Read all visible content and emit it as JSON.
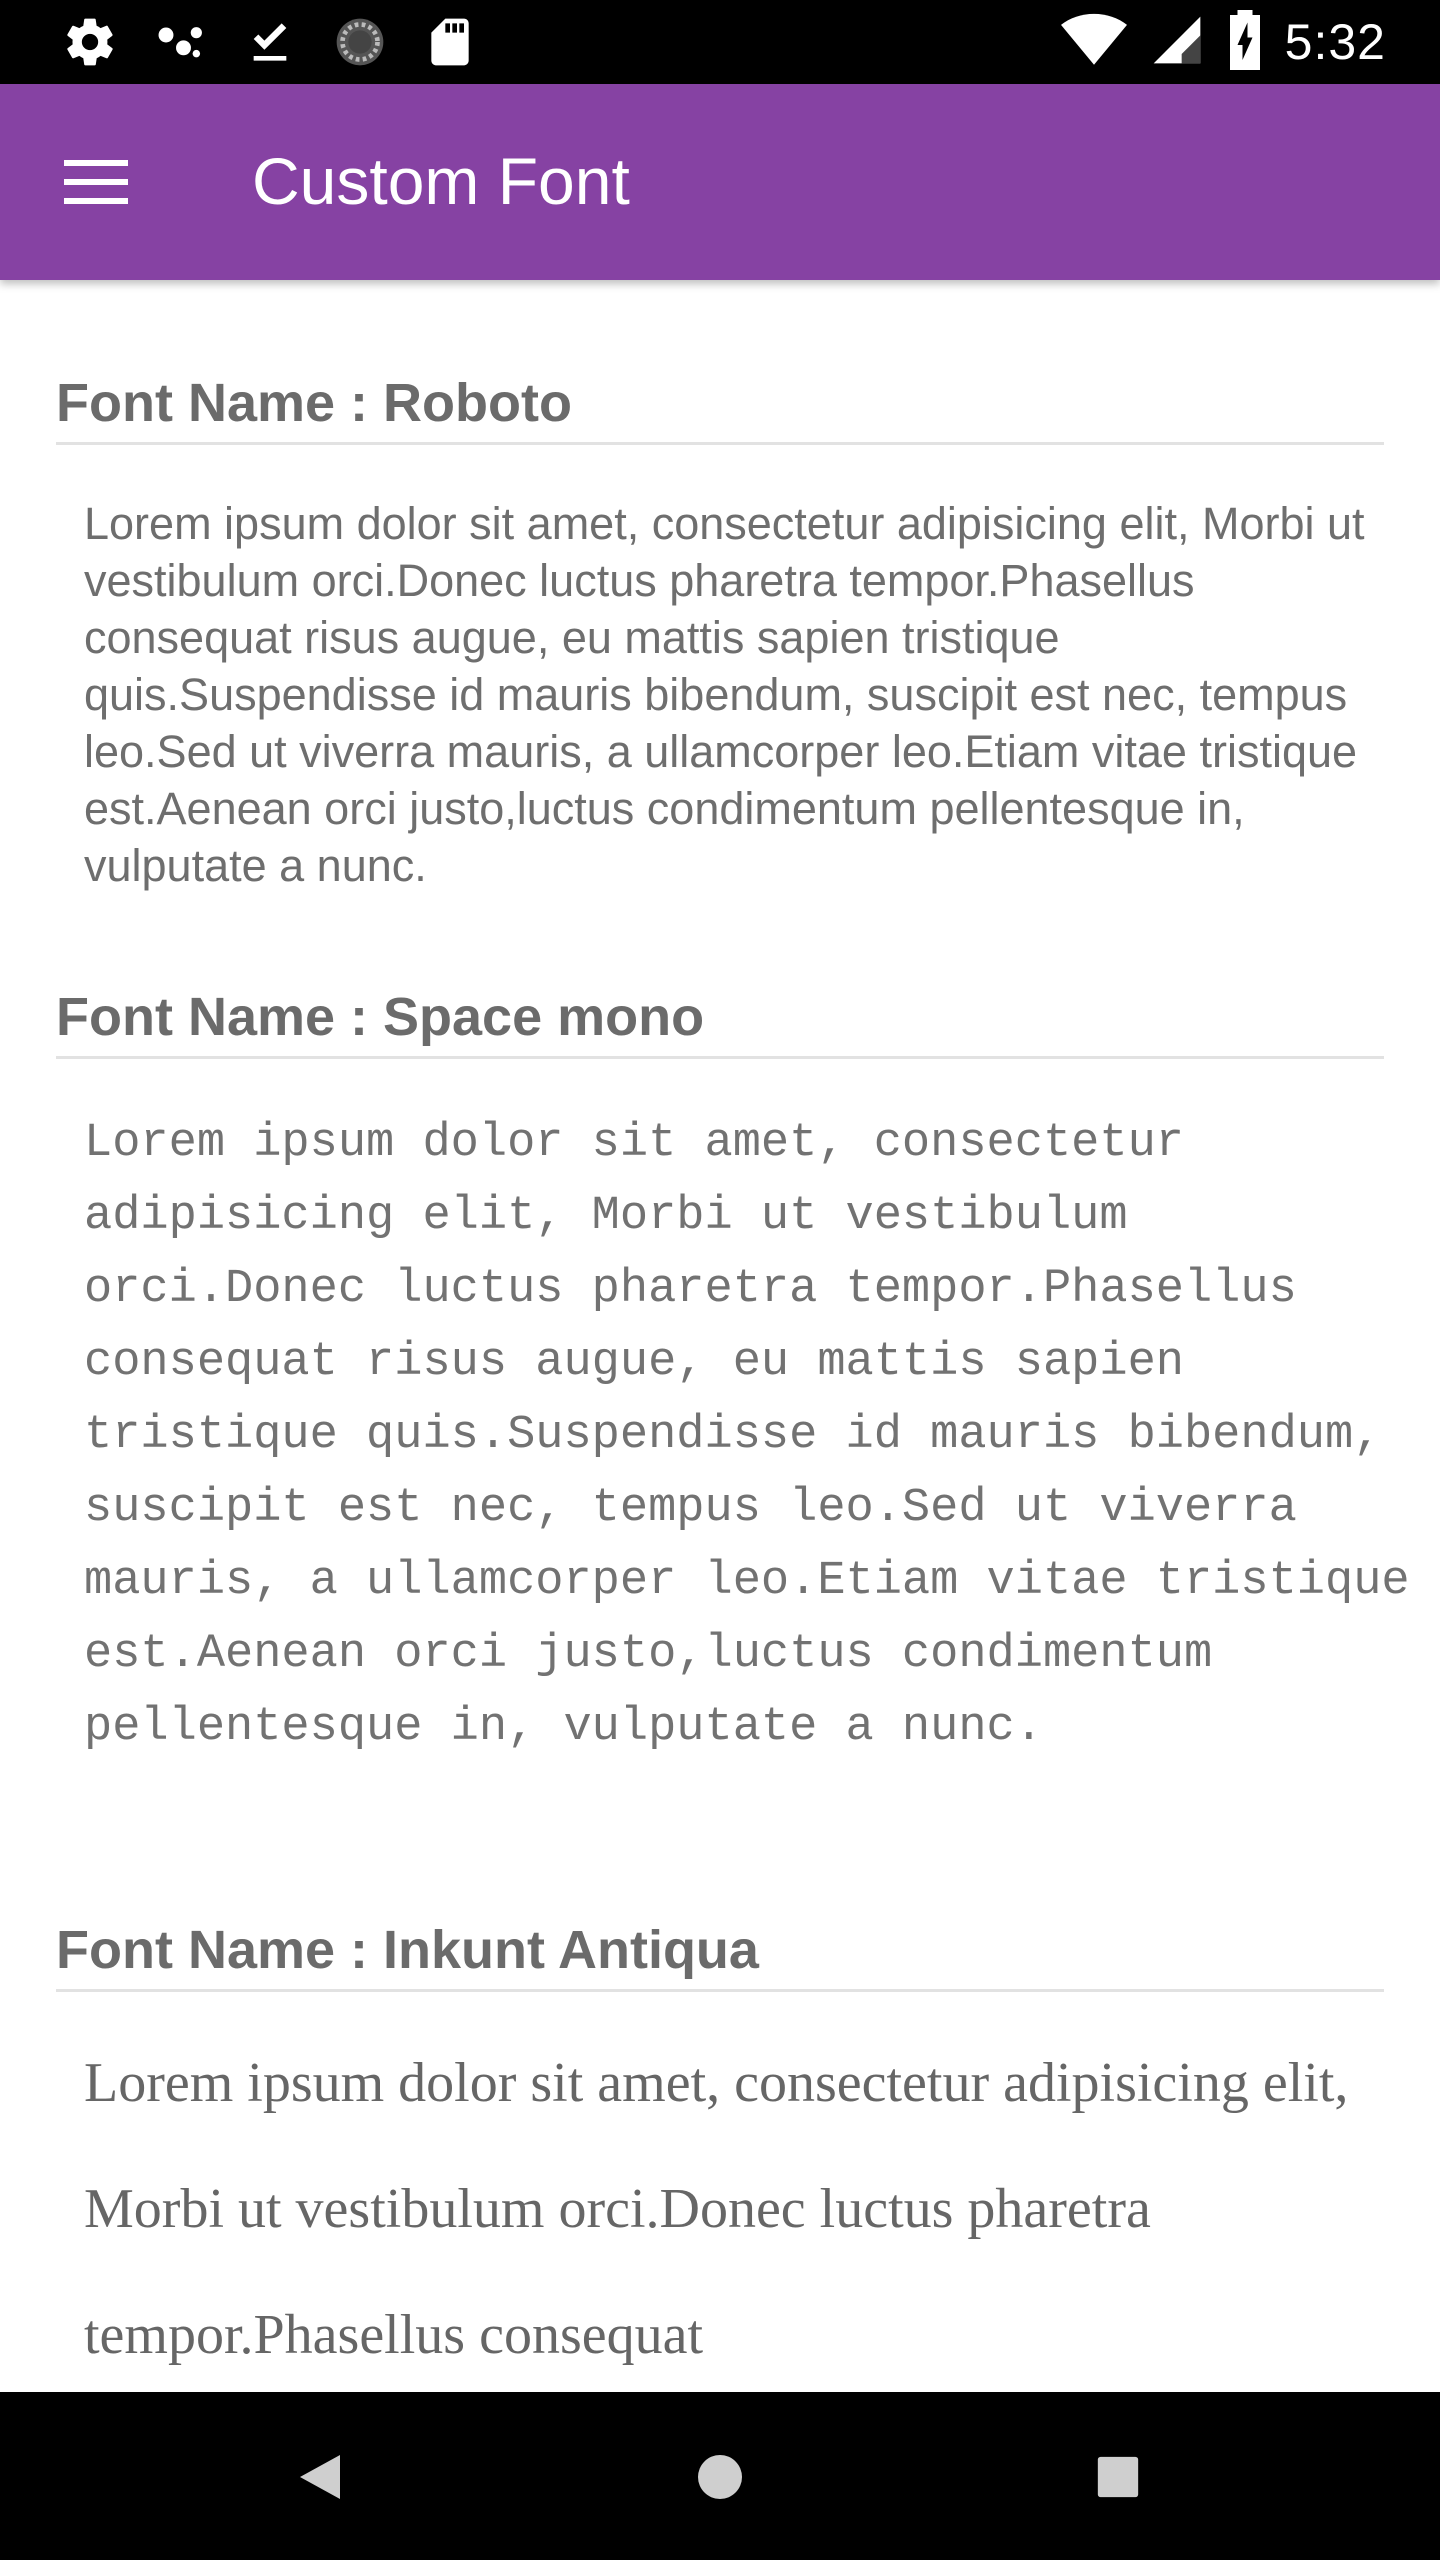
{
  "status_bar": {
    "left_icons": [
      "settings-icon",
      "network-dots-icon",
      "download-done-icon",
      "sync-circle-icon",
      "sd-card-icon"
    ],
    "right_icons": [
      "wifi-icon",
      "signal-icon",
      "battery-charging-icon"
    ],
    "time": "5:32"
  },
  "app_bar": {
    "title": "Custom Font",
    "menu_icon": "hamburger-menu-icon",
    "color": "#8642a3"
  },
  "sections": [
    {
      "title": "Font Name : Roboto",
      "body": "Lorem ipsum dolor sit amet, consectetur adipisicing elit, Morbi ut vestibulum orci.Donec luctus pharetra tempor.Phasellus consequat risus augue, eu mattis sapien tristique quis.Suspendisse id mauris bibendum, suscipit est nec, tempus leo.Sed ut viverra mauris, a ullamcorper leo.Etiam vitae tristique est.Aenean orci justo,luctus condimentum pellentesque in, vulputate a nunc."
    },
    {
      "title": "Font Name : Space mono",
      "body": "Lorem ipsum dolor sit amet, consectetur adipisicing elit, Morbi ut vestibulum orci.Donec luctus pharetra tempor.Phasellus consequat risus augue, eu mattis sapien tristique quis.Suspendisse id mauris bibendum, suscipit est nec, tempus leo.Sed ut viverra mauris, a ullamcorper leo.Etiam vitae tristique est.Aenean orci justo,luctus condimentum pellentesque in, vulputate a nunc."
    },
    {
      "title": "Font Name : Inkunt Antiqua",
      "body": "Lorem ipsum dolor sit amet, consectetur adipisicing elit, Morbi ut vestibulum orci.Donec luctus pharetra tempor.Phasellus consequat"
    }
  ],
  "nav_bar": {
    "icons": [
      "back-icon",
      "home-icon",
      "recents-icon"
    ]
  }
}
